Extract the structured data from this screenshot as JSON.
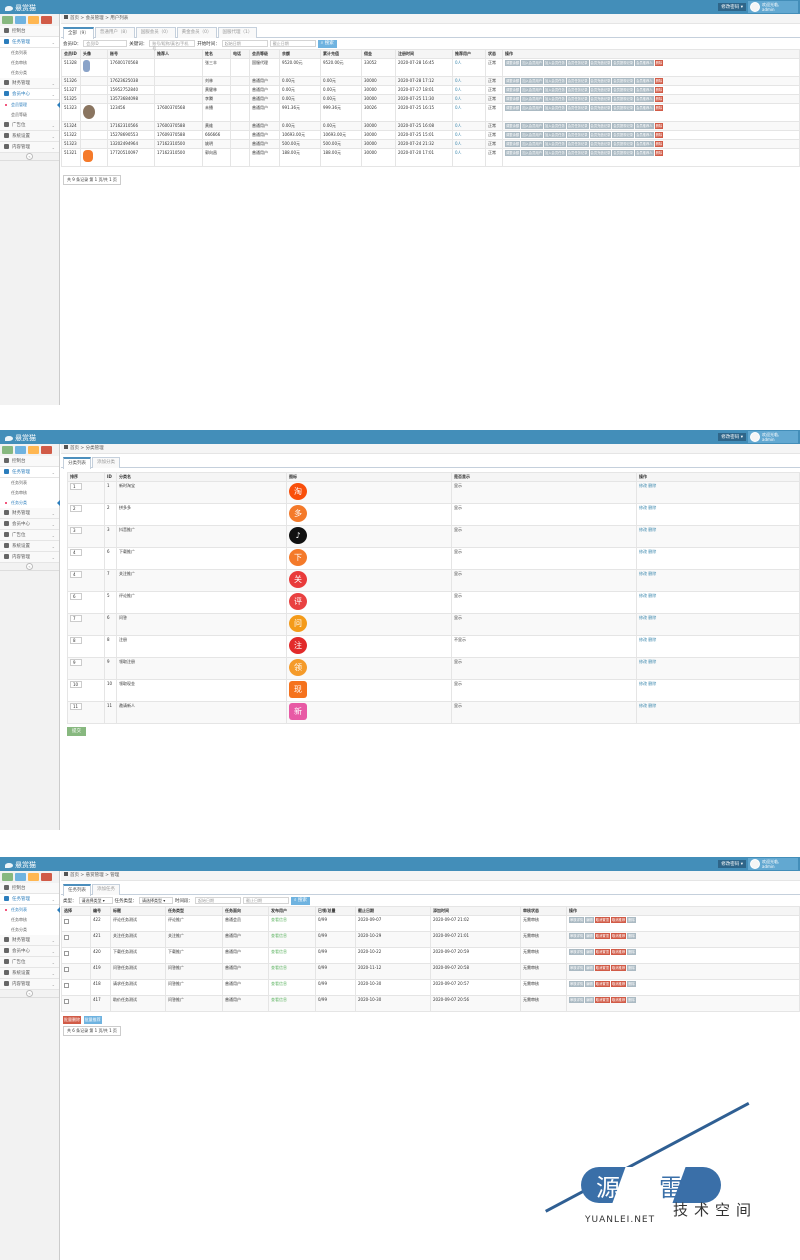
{
  "app": {
    "brand": "悬赏猫",
    "dropdown": "修改密码",
    "user": {
      "greeting": "欢迎光临,",
      "name": "admin"
    },
    "sidebar": {
      "dashboard": "控制台",
      "task_mgmt": "任务管理",
      "task_list": "任务列表",
      "task_review": "任务审核",
      "task_category": "任务分类",
      "finance": "财务管理",
      "members": "会员中心",
      "member_list": "会员管理",
      "member_level": "会员等级",
      "ads": "广告位",
      "system": "系统设置",
      "content": "内容管理"
    },
    "shortcut_colors": [
      "#87b87f",
      "#6fb3e0",
      "#ffb752",
      "#d15b47"
    ]
  },
  "s1": {
    "crumb": [
      "首页",
      "会员管理",
      "用户列表"
    ],
    "tabs": [
      "全部（9）",
      "普通用户（8）",
      "国服会员（0）",
      "黄金会员（0）",
      "国服代理（1）"
    ],
    "filters": {
      "member_label": "会员ID：",
      "member_ph": "会员ID",
      "kw_label": "关键词：",
      "kw_ph": "账号/昵称/真名/手机号",
      "time_label": "开始时间：",
      "from_ph": "起始日期",
      "to_ph": "截止日期",
      "search": "搜索"
    },
    "headers": [
      "会员ID",
      "头像",
      "账号",
      "推荐人",
      "姓名",
      "电话",
      "会员等级",
      "余额",
      "累计充值",
      "佣金",
      "注册时间",
      "推荐用户",
      "状态",
      "操作"
    ],
    "rows": [
      {
        "id": "51328",
        "acct": "17600170568",
        "ref": "",
        "name": "张三丰",
        "phone": "",
        "level": "国服代理",
        "bal": "9520.00元",
        "total": "9520.00元",
        "comm": "33052",
        "time": "2020-07-28 16:45",
        "rec": "0人",
        "status": "正常",
        "thumb": "figure"
      },
      {
        "id": "51326",
        "acct": "17623625038",
        "ref": "",
        "name": "刘林",
        "phone": "",
        "level": "普通用户",
        "bal": "0.00元",
        "total": "0.00元",
        "comm": "30000",
        "time": "2020-07-28 17:12",
        "rec": "0人",
        "status": "正常",
        "thumb": ""
      },
      {
        "id": "51327",
        "acct": "15952752840",
        "ref": "",
        "name": "黄健林",
        "phone": "",
        "level": "普通用户",
        "bal": "0.00元",
        "total": "0.00元",
        "comm": "30000",
        "time": "2020-07-27 18:01",
        "rec": "0人",
        "status": "正常",
        "thumb": ""
      },
      {
        "id": "51325",
        "acct": "13573684098",
        "ref": "",
        "name": "李腾",
        "phone": "",
        "level": "普通用户",
        "bal": "0.00元",
        "total": "0.00元",
        "comm": "30000",
        "time": "2020-07-25 11:30",
        "rec": "0人",
        "status": "正常",
        "thumb": ""
      },
      {
        "id": "51323",
        "acct": "123456",
        "ref": "17600370568",
        "name": "未播",
        "phone": "",
        "level": "普通用户",
        "bal": "991.36元",
        "total": "999.36元",
        "comm": "30026",
        "time": "2020-07-25 16:15",
        "rec": "0人",
        "status": "正常",
        "thumb": "person"
      },
      {
        "id": "51324",
        "acct": "17162310566",
        "ref": "17600370588",
        "name": "黄维",
        "phone": "",
        "level": "普通用户",
        "bal": "0.00元",
        "total": "0.00元",
        "comm": "30000",
        "time": "2020-07-25 16:08",
        "rec": "0人",
        "status": "正常",
        "thumb": ""
      },
      {
        "id": "51322",
        "acct": "15278690553",
        "ref": "17609370588",
        "name": "666666",
        "phone": "",
        "level": "普通用户",
        "bal": "10693.00元",
        "total": "10693.00元",
        "comm": "30000",
        "time": "2020-07-25 15:01",
        "rec": "0人",
        "status": "正常",
        "thumb": ""
      },
      {
        "id": "51323",
        "acct": "13202494964",
        "ref": "17162310500",
        "name": "姚明",
        "phone": "",
        "level": "普通用户",
        "bal": "500.00元",
        "total": "500.00元",
        "comm": "30000",
        "time": "2020-07-24 21:32",
        "rec": "0人",
        "status": "正常",
        "thumb": ""
      },
      {
        "id": "51321",
        "acct": "17720510097",
        "ref": "17162310500",
        "name": "郭向昌",
        "phone": "",
        "level": "普通用户",
        "bal": "188.00元",
        "total": "188.00元",
        "comm": "30000",
        "time": "2020-07-20 17:01",
        "rec": "0人",
        "status": "正常",
        "thumb": "fox"
      }
    ],
    "ops": [
      "调整余额",
      "加入会员用户",
      "加入会员任务",
      "会员任务记录",
      "会员充值记录",
      "会员提现记录",
      "会员推荐人",
      "删除"
    ],
    "pager": "共 9 条记录 第 1 页/共 1 页"
  },
  "s2": {
    "crumb": [
      "首页",
      "分类管理"
    ],
    "tabs": [
      "分类列表",
      "添加分类"
    ],
    "headers": [
      "排序",
      "ID",
      "分类名",
      "图标",
      "是否显示",
      "操作"
    ],
    "rows": [
      {
        "sort": "1",
        "id": "1",
        "name": "新时淘宝",
        "show": "显示",
        "icon": "淘",
        "color": "#f94f0b"
      },
      {
        "sort": "2",
        "id": "2",
        "name": "拼多多",
        "show": "显示",
        "icon": "多",
        "color": "#f47a2a"
      },
      {
        "sort": "3",
        "id": "3",
        "name": "抖音推广",
        "show": "显示",
        "icon": "♪",
        "color": "#111111"
      },
      {
        "sort": "4",
        "id": "6",
        "name": "下载推广",
        "show": "显示",
        "icon": "下",
        "color": "#f47a2a"
      },
      {
        "sort": "4",
        "id": "7",
        "name": "关注推广",
        "show": "显示",
        "icon": "关",
        "color": "#e93b3b"
      },
      {
        "sort": "6",
        "id": "5",
        "name": "评论推广",
        "show": "显示",
        "icon": "评",
        "color": "#e94141"
      },
      {
        "sort": "7",
        "id": "6",
        "name": "问答",
        "show": "显示",
        "icon": "问",
        "color": "#f49b1a"
      },
      {
        "sort": "8",
        "id": "8",
        "name": "注册",
        "show": "不显示",
        "icon": "注",
        "color": "#e22a2a"
      },
      {
        "sort": "9",
        "id": "9",
        "name": "领取注册",
        "show": "显示",
        "icon": "领",
        "color": "#f59b2a"
      },
      {
        "sort": "10",
        "id": "10",
        "name": "领取现金",
        "show": "显示",
        "icon": "现",
        "color": "#f5721d"
      },
      {
        "sort": "11",
        "id": "11",
        "name": "邀请新人",
        "show": "显示",
        "icon": "新",
        "color": "#e85aa5"
      }
    ],
    "row_ops": "修改 删除",
    "save": "提交"
  },
  "s3": {
    "crumb": [
      "首页",
      "悬赏管理",
      "管理"
    ],
    "tabs": [
      "任务列表",
      "添加任务"
    ],
    "filters": {
      "type_label": "类型：",
      "type_val": "请选择类型",
      "cat_label": "任务类型：",
      "cat_val": "请选择类型",
      "time_label": "时间段：",
      "from_ph": "起始日期",
      "to_ph": "截止日期",
      "search": "搜索"
    },
    "headers": [
      "选择",
      "编号",
      "标题",
      "任务类型",
      "任务面向",
      "发布用户",
      "已领/总量",
      "截止日期",
      "添加时间",
      "审核状态",
      "操作"
    ],
    "rows": [
      {
        "no": "422",
        "title": "评论任务测试",
        "type": "评论推广",
        "face": "普通会员",
        "user": "查看信息",
        "count": "0/99",
        "deadline": "2020-09-07",
        "added": "2020-09-07 21:02",
        "state": "无需审核"
      },
      {
        "no": "421",
        "title": "关注任务测试",
        "type": "关注推广",
        "face": "普通用户",
        "user": "查看信息",
        "count": "0/99",
        "deadline": "2020-10-29",
        "added": "2020-09-07 21:01",
        "state": "无需审核"
      },
      {
        "no": "420",
        "title": "下载任务测试",
        "type": "下载推广",
        "face": "普通用户",
        "user": "查看信息",
        "count": "0/99",
        "deadline": "2020-10-22",
        "added": "2020-09-07 20:59",
        "state": "无需审核"
      },
      {
        "no": "419",
        "title": "问答任务测试",
        "type": "问答推广",
        "face": "普通用户",
        "user": "查看信息",
        "count": "0/99",
        "deadline": "2020-11-12",
        "added": "2020-09-07 20:58",
        "state": "无需审核"
      },
      {
        "no": "418",
        "title": "请求任务测试",
        "type": "问答推广",
        "face": "普通用户",
        "user": "查看信息",
        "count": "0/99",
        "deadline": "2020-10-30",
        "added": "2020-09-07 20:57",
        "state": "无需审核"
      },
      {
        "no": "417",
        "title": "助价任务测试",
        "type": "问答推广",
        "face": "普通用户",
        "user": "查看信息",
        "count": "0/99",
        "deadline": "2020-10-30",
        "added": "2020-09-07 20:56",
        "state": "无需审核"
      }
    ],
    "ops": [
      "审核详情",
      "编辑",
      "取消置顶",
      "取消推荐",
      "删除"
    ],
    "bulk": [
      "批量删除",
      "批量推荐"
    ],
    "pager": "共 6 条记录 第 1 页/共 1 页"
  },
  "watermark": {
    "left": "源",
    "right": "雷",
    "cn": "技术空间",
    "en": "YUANLEI.NET"
  }
}
